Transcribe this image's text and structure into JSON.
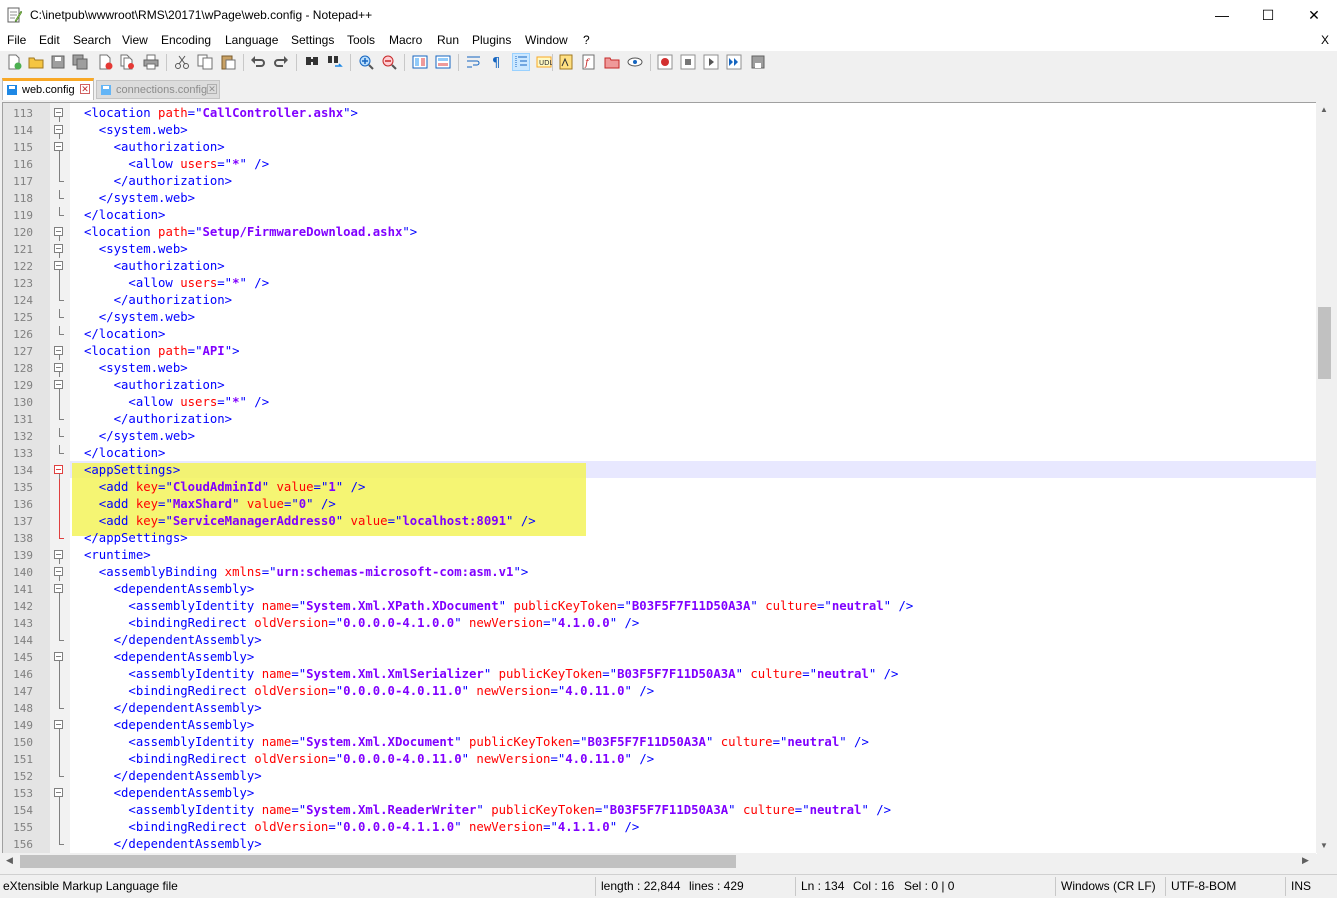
{
  "window": {
    "title": "C:\\inetpub\\wwwroot\\RMS\\20171\\wPage\\web.config - Notepad++",
    "minimize": "—",
    "maximize": "☐",
    "close": "✕"
  },
  "menu": {
    "items": [
      "File",
      "Edit",
      "Search",
      "View",
      "Encoding",
      "Language",
      "Settings",
      "Tools",
      "Macro",
      "Run",
      "Plugins",
      "Window",
      "?"
    ],
    "close_doc": "X"
  },
  "toolbar": {
    "icons": [
      "new-file-icon",
      "open-file-icon",
      "save-icon",
      "save-all-icon",
      "close-icon",
      "close-all-icon",
      "print-icon",
      "cut-icon",
      "copy-icon",
      "paste-icon",
      "undo-icon",
      "redo-icon",
      "find-icon",
      "replace-icon",
      "zoom-in-icon",
      "zoom-out-icon",
      "sync-vertical-icon",
      "sync-horizontal-icon",
      "word-wrap-icon",
      "show-all-chars-icon",
      "indent-guide-icon",
      "user-language-icon",
      "doc-map-icon",
      "function-list-icon",
      "folder-workspace-icon",
      "monitor-icon",
      "record-macro-icon",
      "stop-record-icon",
      "play-macro-icon",
      "run-macro-multiple-icon",
      "save-macro-icon"
    ]
  },
  "tabs": [
    {
      "label": "web.config",
      "active": true
    },
    {
      "label": "connections.config",
      "active": false
    }
  ],
  "editor": {
    "lines": [
      {
        "n": "113",
        "parts": [
          [
            "t",
            "<location "
          ],
          [
            "a",
            "path"
          ],
          [
            "t",
            "=\""
          ],
          [
            "v",
            "CallController.ashx"
          ],
          [
            "t",
            "\">"
          ]
        ]
      },
      {
        "n": "114",
        "parts": [
          [
            "t",
            "  <system.web>"
          ]
        ]
      },
      {
        "n": "115",
        "parts": [
          [
            "t",
            "    <authorization>"
          ]
        ]
      },
      {
        "n": "116",
        "parts": [
          [
            "t",
            "      <allow "
          ],
          [
            "a",
            "users"
          ],
          [
            "t",
            "=\""
          ],
          [
            "v",
            "*"
          ],
          [
            "t",
            "\" />"
          ]
        ]
      },
      {
        "n": "117",
        "parts": [
          [
            "t",
            "    </authorization>"
          ]
        ]
      },
      {
        "n": "118",
        "parts": [
          [
            "t",
            "  </system.web>"
          ]
        ]
      },
      {
        "n": "119",
        "parts": [
          [
            "t",
            "</location>"
          ]
        ]
      },
      {
        "n": "120",
        "parts": [
          [
            "t",
            "<location "
          ],
          [
            "a",
            "path"
          ],
          [
            "t",
            "=\""
          ],
          [
            "v",
            "Setup/FirmwareDownload.ashx"
          ],
          [
            "t",
            "\">"
          ]
        ]
      },
      {
        "n": "121",
        "parts": [
          [
            "t",
            "  <system.web>"
          ]
        ]
      },
      {
        "n": "122",
        "parts": [
          [
            "t",
            "    <authorization>"
          ]
        ]
      },
      {
        "n": "123",
        "parts": [
          [
            "t",
            "      <allow "
          ],
          [
            "a",
            "users"
          ],
          [
            "t",
            "=\""
          ],
          [
            "v",
            "*"
          ],
          [
            "t",
            "\" />"
          ]
        ]
      },
      {
        "n": "124",
        "parts": [
          [
            "t",
            "    </authorization>"
          ]
        ]
      },
      {
        "n": "125",
        "parts": [
          [
            "t",
            "  </system.web>"
          ]
        ]
      },
      {
        "n": "126",
        "parts": [
          [
            "t",
            "</location>"
          ]
        ]
      },
      {
        "n": "127",
        "parts": [
          [
            "t",
            "<location "
          ],
          [
            "a",
            "path"
          ],
          [
            "t",
            "=\""
          ],
          [
            "v",
            "API"
          ],
          [
            "t",
            "\">"
          ]
        ]
      },
      {
        "n": "128",
        "parts": [
          [
            "t",
            "  <system.web>"
          ]
        ]
      },
      {
        "n": "129",
        "parts": [
          [
            "t",
            "    <authorization>"
          ]
        ]
      },
      {
        "n": "130",
        "parts": [
          [
            "t",
            "      <allow "
          ],
          [
            "a",
            "users"
          ],
          [
            "t",
            "=\""
          ],
          [
            "v",
            "*"
          ],
          [
            "t",
            "\" />"
          ]
        ]
      },
      {
        "n": "131",
        "parts": [
          [
            "t",
            "    </authorization>"
          ]
        ]
      },
      {
        "n": "132",
        "parts": [
          [
            "t",
            "  </system.web>"
          ]
        ]
      },
      {
        "n": "133",
        "parts": [
          [
            "t",
            "</location>"
          ]
        ]
      },
      {
        "n": "134",
        "parts": [
          [
            "t",
            "<appSettings>"
          ]
        ]
      },
      {
        "n": "135",
        "parts": [
          [
            "t",
            "  <add "
          ],
          [
            "a",
            "key"
          ],
          [
            "t",
            "=\""
          ],
          [
            "v",
            "CloudAdminId"
          ],
          [
            "t",
            "\" "
          ],
          [
            "a",
            "value"
          ],
          [
            "t",
            "=\""
          ],
          [
            "v",
            "1"
          ],
          [
            "t",
            "\" />"
          ]
        ]
      },
      {
        "n": "136",
        "parts": [
          [
            "t",
            "  <add "
          ],
          [
            "a",
            "key"
          ],
          [
            "t",
            "=\""
          ],
          [
            "v",
            "MaxShard"
          ],
          [
            "t",
            "\" "
          ],
          [
            "a",
            "value"
          ],
          [
            "t",
            "=\""
          ],
          [
            "v",
            "0"
          ],
          [
            "t",
            "\" />"
          ]
        ]
      },
      {
        "n": "137",
        "parts": [
          [
            "t",
            "  <add "
          ],
          [
            "a",
            "key"
          ],
          [
            "t",
            "=\""
          ],
          [
            "v",
            "ServiceManagerAddress0"
          ],
          [
            "t",
            "\" "
          ],
          [
            "a",
            "value"
          ],
          [
            "t",
            "=\""
          ],
          [
            "v",
            "localhost:8091"
          ],
          [
            "t",
            "\" />"
          ]
        ]
      },
      {
        "n": "138",
        "parts": [
          [
            "t",
            "</appSettings>"
          ]
        ]
      },
      {
        "n": "139",
        "parts": [
          [
            "t",
            "<runtime>"
          ]
        ]
      },
      {
        "n": "140",
        "parts": [
          [
            "t",
            "  <assemblyBinding "
          ],
          [
            "a",
            "xmlns"
          ],
          [
            "t",
            "=\""
          ],
          [
            "v",
            "urn:schemas-microsoft-com:asm.v1"
          ],
          [
            "t",
            "\">"
          ]
        ]
      },
      {
        "n": "141",
        "parts": [
          [
            "t",
            "    <dependentAssembly>"
          ]
        ]
      },
      {
        "n": "142",
        "parts": [
          [
            "t",
            "      <assemblyIdentity "
          ],
          [
            "a",
            "name"
          ],
          [
            "t",
            "=\""
          ],
          [
            "v",
            "System.Xml.XPath.XDocument"
          ],
          [
            "t",
            "\" "
          ],
          [
            "a",
            "publicKeyToken"
          ],
          [
            "t",
            "=\""
          ],
          [
            "v",
            "B03F5F7F11D50A3A"
          ],
          [
            "t",
            "\" "
          ],
          [
            "a",
            "culture"
          ],
          [
            "t",
            "=\""
          ],
          [
            "v",
            "neutral"
          ],
          [
            "t",
            "\" />"
          ]
        ]
      },
      {
        "n": "143",
        "parts": [
          [
            "t",
            "      <bindingRedirect "
          ],
          [
            "a",
            "oldVersion"
          ],
          [
            "t",
            "=\""
          ],
          [
            "v",
            "0.0.0.0-4.1.0.0"
          ],
          [
            "t",
            "\" "
          ],
          [
            "a",
            "newVersion"
          ],
          [
            "t",
            "=\""
          ],
          [
            "v",
            "4.1.0.0"
          ],
          [
            "t",
            "\" />"
          ]
        ]
      },
      {
        "n": "144",
        "parts": [
          [
            "t",
            "    </dependentAssembly>"
          ]
        ]
      },
      {
        "n": "145",
        "parts": [
          [
            "t",
            "    <dependentAssembly>"
          ]
        ]
      },
      {
        "n": "146",
        "parts": [
          [
            "t",
            "      <assemblyIdentity "
          ],
          [
            "a",
            "name"
          ],
          [
            "t",
            "=\""
          ],
          [
            "v",
            "System.Xml.XmlSerializer"
          ],
          [
            "t",
            "\" "
          ],
          [
            "a",
            "publicKeyToken"
          ],
          [
            "t",
            "=\""
          ],
          [
            "v",
            "B03F5F7F11D50A3A"
          ],
          [
            "t",
            "\" "
          ],
          [
            "a",
            "culture"
          ],
          [
            "t",
            "=\""
          ],
          [
            "v",
            "neutral"
          ],
          [
            "t",
            "\" />"
          ]
        ]
      },
      {
        "n": "147",
        "parts": [
          [
            "t",
            "      <bindingRedirect "
          ],
          [
            "a",
            "oldVersion"
          ],
          [
            "t",
            "=\""
          ],
          [
            "v",
            "0.0.0.0-4.0.11.0"
          ],
          [
            "t",
            "\" "
          ],
          [
            "a",
            "newVersion"
          ],
          [
            "t",
            "=\""
          ],
          [
            "v",
            "4.0.11.0"
          ],
          [
            "t",
            "\" />"
          ]
        ]
      },
      {
        "n": "148",
        "parts": [
          [
            "t",
            "    </dependentAssembly>"
          ]
        ]
      },
      {
        "n": "149",
        "parts": [
          [
            "t",
            "    <dependentAssembly>"
          ]
        ]
      },
      {
        "n": "150",
        "parts": [
          [
            "t",
            "      <assemblyIdentity "
          ],
          [
            "a",
            "name"
          ],
          [
            "t",
            "=\""
          ],
          [
            "v",
            "System.Xml.XDocument"
          ],
          [
            "t",
            "\" "
          ],
          [
            "a",
            "publicKeyToken"
          ],
          [
            "t",
            "=\""
          ],
          [
            "v",
            "B03F5F7F11D50A3A"
          ],
          [
            "t",
            "\" "
          ],
          [
            "a",
            "culture"
          ],
          [
            "t",
            "=\""
          ],
          [
            "v",
            "neutral"
          ],
          [
            "t",
            "\" />"
          ]
        ]
      },
      {
        "n": "151",
        "parts": [
          [
            "t",
            "      <bindingRedirect "
          ],
          [
            "a",
            "oldVersion"
          ],
          [
            "t",
            "=\""
          ],
          [
            "v",
            "0.0.0.0-4.0.11.0"
          ],
          [
            "t",
            "\" "
          ],
          [
            "a",
            "newVersion"
          ],
          [
            "t",
            "=\""
          ],
          [
            "v",
            "4.0.11.0"
          ],
          [
            "t",
            "\" />"
          ]
        ]
      },
      {
        "n": "152",
        "parts": [
          [
            "t",
            "    </dependentAssembly>"
          ]
        ]
      },
      {
        "n": "153",
        "parts": [
          [
            "t",
            "    <dependentAssembly>"
          ]
        ]
      },
      {
        "n": "154",
        "parts": [
          [
            "t",
            "      <assemblyIdentity "
          ],
          [
            "a",
            "name"
          ],
          [
            "t",
            "=\""
          ],
          [
            "v",
            "System.Xml.ReaderWriter"
          ],
          [
            "t",
            "\" "
          ],
          [
            "a",
            "publicKeyToken"
          ],
          [
            "t",
            "=\""
          ],
          [
            "v",
            "B03F5F7F11D50A3A"
          ],
          [
            "t",
            "\" "
          ],
          [
            "a",
            "culture"
          ],
          [
            "t",
            "=\""
          ],
          [
            "v",
            "neutral"
          ],
          [
            "t",
            "\" />"
          ]
        ]
      },
      {
        "n": "155",
        "parts": [
          [
            "t",
            "      <bindingRedirect "
          ],
          [
            "a",
            "oldVersion"
          ],
          [
            "t",
            "=\""
          ],
          [
            "v",
            "0.0.0.0-4.1.1.0"
          ],
          [
            "t",
            "\" "
          ],
          [
            "a",
            "newVersion"
          ],
          [
            "t",
            "=\""
          ],
          [
            "v",
            "4.1.1.0"
          ],
          [
            "t",
            "\" />"
          ]
        ]
      },
      {
        "n": "156",
        "parts": [
          [
            "t",
            "    </dependentAssembly>"
          ]
        ]
      }
    ],
    "current_line": "134",
    "highlighted_lines": [
      "134",
      "135",
      "136",
      "137"
    ]
  },
  "status": {
    "file_type": "eXtensible Markup Language file",
    "length": "length : 22,844",
    "lines": "lines : 429",
    "ln": "Ln : 134",
    "col": "Col : 16",
    "sel": "Sel : 0 | 0",
    "eol": "Windows (CR LF)",
    "encoding": "UTF-8-BOM",
    "mode": "INS"
  },
  "colors": {
    "tag": "#0000ff",
    "attribute": "#ff0000",
    "value": "#8000ff",
    "highlight": "#f3f35a",
    "active_tab_accent": "#f9a825"
  }
}
